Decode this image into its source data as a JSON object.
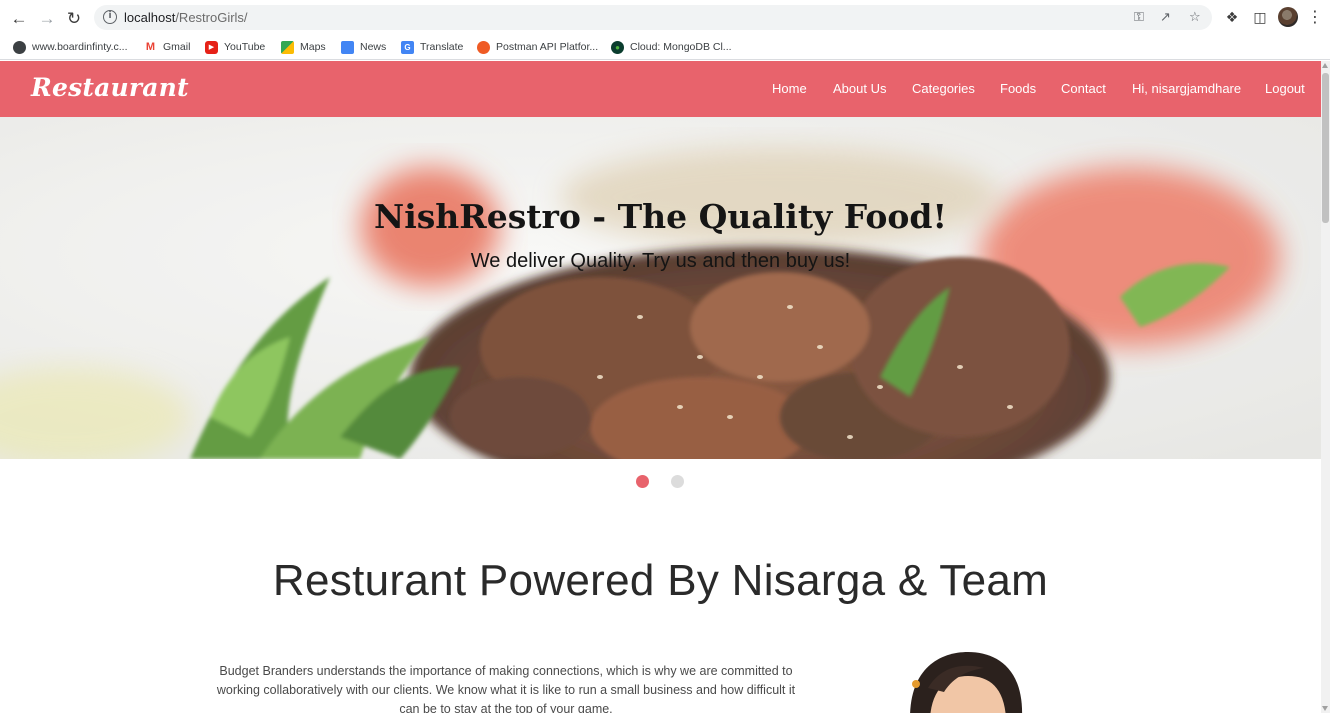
{
  "browser": {
    "url_host": "localhost",
    "url_path": "/RestroGirls/",
    "bookmarks": [
      {
        "label": "www.boardinfinty.c...",
        "icon": "globe-icon"
      },
      {
        "label": "Gmail",
        "icon": "gmail-icon"
      },
      {
        "label": "YouTube",
        "icon": "youtube-icon"
      },
      {
        "label": "Maps",
        "icon": "maps-icon"
      },
      {
        "label": "News",
        "icon": "news-icon"
      },
      {
        "label": "Translate",
        "icon": "translate-icon"
      },
      {
        "label": "Postman API Platfor...",
        "icon": "postman-icon"
      },
      {
        "label": "Cloud: MongoDB Cl...",
        "icon": "mongodb-icon"
      }
    ]
  },
  "site": {
    "brand": "Restaurant",
    "accent_color": "#e8636c",
    "menu": [
      "Home",
      "About Us",
      "Categories",
      "Foods",
      "Contact",
      "Hi, nisargjamdhare",
      "Logout"
    ]
  },
  "hero": {
    "title": "NishRestro - The Quality Food!",
    "subtitle": "We deliver Quality. Try us and then buy us!",
    "slides": 2,
    "active_slide": 1
  },
  "about": {
    "heading": "Resturant Powered By Nisarga & Team",
    "text": "Budget Branders understands the importance of making connections, which is why we are committed to working collaboratively with our clients. We know what it is like to run a small business and how difficult it can be to stay at the top of your game."
  }
}
